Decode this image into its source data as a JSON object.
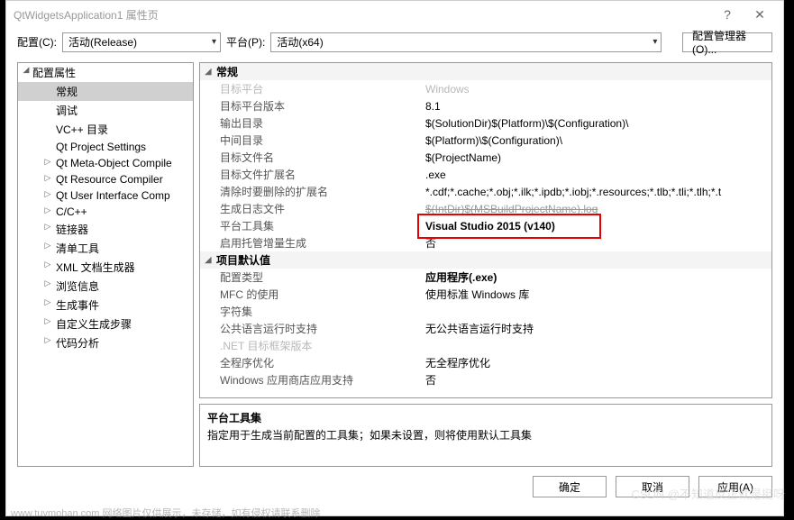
{
  "window": {
    "title": "QtWidgetsApplication1 属性页",
    "help": "?",
    "close": "✕"
  },
  "toolbar": {
    "config_label": "配置(C):",
    "config_value": "活动(Release)",
    "platform_label": "平台(P):",
    "platform_value": "活动(x64)",
    "manager_label": "配置管理器(O)..."
  },
  "tree": [
    {
      "label": "配置属性",
      "level": 0,
      "exp": "◢"
    },
    {
      "label": "常规",
      "level": 1,
      "sel": true
    },
    {
      "label": "调试",
      "level": 1
    },
    {
      "label": "VC++ 目录",
      "level": 1
    },
    {
      "label": "Qt Project Settings",
      "level": 1
    },
    {
      "label": "Qt Meta-Object Compile",
      "level": 1,
      "exp": "▷"
    },
    {
      "label": "Qt Resource Compiler",
      "level": 1,
      "exp": "▷"
    },
    {
      "label": "Qt User Interface Comp",
      "level": 1,
      "exp": "▷"
    },
    {
      "label": "C/C++",
      "level": 1,
      "exp": "▷"
    },
    {
      "label": "链接器",
      "level": 1,
      "exp": "▷"
    },
    {
      "label": "清单工具",
      "level": 1,
      "exp": "▷"
    },
    {
      "label": "XML 文档生成器",
      "level": 1,
      "exp": "▷"
    },
    {
      "label": "浏览信息",
      "level": 1,
      "exp": "▷"
    },
    {
      "label": "生成事件",
      "level": 1,
      "exp": "▷"
    },
    {
      "label": "自定义生成步骤",
      "level": 1,
      "exp": "▷"
    },
    {
      "label": "代码分析",
      "level": 1,
      "exp": "▷"
    }
  ],
  "grid": [
    {
      "type": "group",
      "label": "常规"
    },
    {
      "type": "prop",
      "name": "目标平台",
      "value": "Windows",
      "dim": true
    },
    {
      "type": "prop",
      "name": "目标平台版本",
      "value": "8.1"
    },
    {
      "type": "prop",
      "name": "输出目录",
      "value": "$(SolutionDir)$(Platform)\\$(Configuration)\\"
    },
    {
      "type": "prop",
      "name": "中间目录",
      "value": "$(Platform)\\$(Configuration)\\"
    },
    {
      "type": "prop",
      "name": "目标文件名",
      "value": "$(ProjectName)"
    },
    {
      "type": "prop",
      "name": "目标文件扩展名",
      "value": ".exe"
    },
    {
      "type": "prop",
      "name": "清除时要删除的扩展名",
      "value": "*.cdf;*.cache;*.obj;*.ilk;*.ipdb;*.iobj;*.resources;*.tlb;*.tli;*.tlh;*.t"
    },
    {
      "type": "prop",
      "name": "生成日志文件",
      "value": "$(IntDir)$(MSBuildProjectName).log",
      "strike": true
    },
    {
      "type": "prop",
      "name": "平台工具集",
      "value": "Visual Studio 2015 (v140)",
      "bold": true,
      "highlight": true
    },
    {
      "type": "prop",
      "name": "启用托管增量生成",
      "value": "否"
    },
    {
      "type": "group",
      "label": "项目默认值"
    },
    {
      "type": "prop",
      "name": "配置类型",
      "value": "应用程序(.exe)",
      "bold": true
    },
    {
      "type": "prop",
      "name": "MFC 的使用",
      "value": "使用标准 Windows 库"
    },
    {
      "type": "prop",
      "name": "字符集",
      "value": ""
    },
    {
      "type": "prop",
      "name": "公共语言运行时支持",
      "value": "无公共语言运行时支持"
    },
    {
      "type": "prop",
      "name": ".NET 目标框架版本",
      "value": "",
      "dim": true
    },
    {
      "type": "prop",
      "name": "全程序优化",
      "value": "无全程序优化"
    },
    {
      "type": "prop",
      "name": "Windows 应用商店应用支持",
      "value": "否"
    }
  ],
  "desc": {
    "title": "平台工具集",
    "text": "指定用于生成当前配置的工具集；如果未设置，则将使用默认工具集"
  },
  "footer": {
    "ok": "确定",
    "cancel": "取消",
    "apply": "应用(A)"
  },
  "watermark": "CSDN @不知道反正就是挺呀",
  "bottom_text": "www.tuvmohan.com 网络图片仅供展示，未存储，如有侵权请联系删除"
}
